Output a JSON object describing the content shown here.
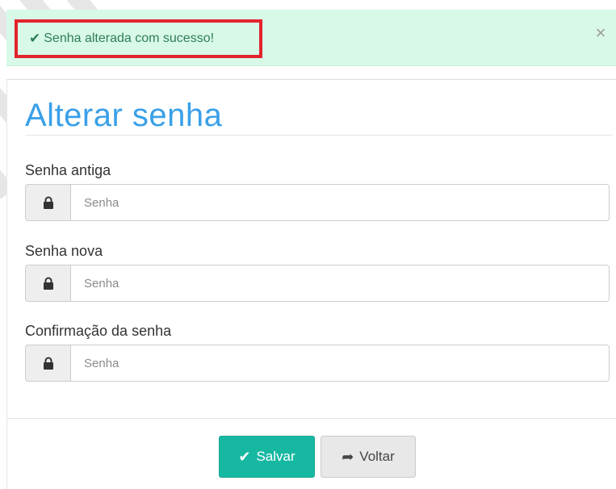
{
  "alert": {
    "message": "Senha alterada com sucesso!",
    "check_icon": "✔",
    "close_icon": "×",
    "color": "#2e7d55"
  },
  "form": {
    "title": "Alterar senha",
    "fields": [
      {
        "label": "Senha antiga",
        "placeholder": "Senha",
        "value": ""
      },
      {
        "label": "Senha nova",
        "placeholder": "Senha",
        "value": ""
      },
      {
        "label": "Confirmação da senha",
        "placeholder": "Senha",
        "value": ""
      }
    ]
  },
  "buttons": {
    "save_label": "Salvar",
    "save_icon": "✔",
    "back_label": "Voltar",
    "back_icon": "➦"
  },
  "colors": {
    "title": "#3aa0e8",
    "save": "#17b8a2",
    "alert_bg": "#d8f8e8",
    "alert_outline": "#e3242b"
  }
}
